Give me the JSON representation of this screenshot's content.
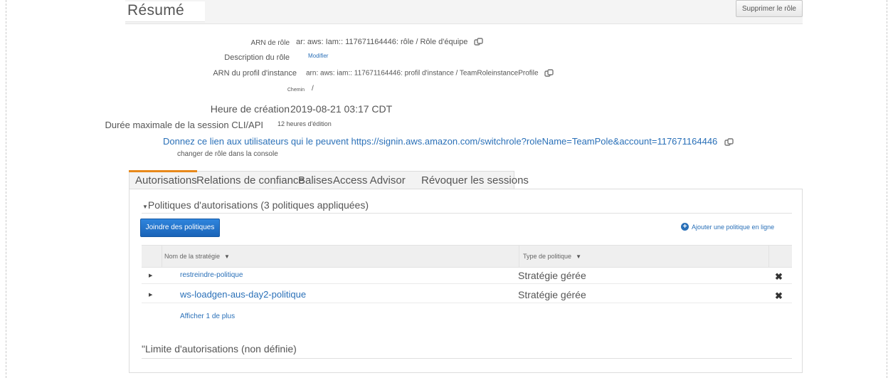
{
  "page": {
    "title": "Résumé",
    "delete_role_label": "Supprimer le rôle"
  },
  "summary": {
    "role_arn": {
      "label": "ARN de rôle",
      "value": "ar: aws: Iam:: 117671164446: rôle / Rôle d'équipe"
    },
    "role_description": {
      "label": "Description du rôle",
      "value": "Modifier"
    },
    "instance_profile_arn": {
      "label": "ARN du profil d'instance",
      "value": "arn: aws: iam:: 117671164446: profil d'instance / TeamRoleinstanceProfile"
    },
    "path": {
      "label": "Chemin",
      "value": "/"
    },
    "creation_time": {
      "label": "Heure de création",
      "value": "2019-08-21 03:17 CDT"
    },
    "max_session": {
      "label": "Durée maximale de la session CLI/API",
      "value": "12 heures d'édition"
    },
    "switch_role": {
      "text": "Donnez ce lien aux utilisateurs qui le peuvent",
      "url": "https://signin.aws.amazon.com/switchrole?roleName=TeamPole&account=117671164446",
      "subtext": "changer de rôle dans la console"
    }
  },
  "tabs": [
    {
      "label": "Autorisations",
      "active": true
    },
    {
      "label": "Relations de confiance",
      "active": false
    },
    {
      "label": "Balises",
      "active": false
    },
    {
      "label": "Access Advisor",
      "active": false
    },
    {
      "label": "Révoquer les sessions",
      "active": false
    }
  ],
  "permissions": {
    "section_title": "Politiques d'autorisations (3 politiques appliquées)",
    "attach_button": "Joindre des politiques",
    "add_inline_link": "Ajouter une politique en ligne",
    "columns": {
      "policy_name": "Nom de la stratégie",
      "policy_type": "Type de politique"
    },
    "rows": [
      {
        "name": "restreindre-politique",
        "type": "Stratégie gérée"
      },
      {
        "name": "ws-loadgen-aus-day2-politique",
        "type": "Stratégie gérée"
      }
    ],
    "show_more": "Afficher 1 de plus",
    "boundary_title": "Limite d'autorisations (non définie)"
  },
  "icons": {
    "copy": "copy-icon",
    "remove": "close-icon",
    "expand": "triangle-right-icon",
    "sort": "caret-down-icon",
    "add": "plus-circle-icon"
  },
  "colors": {
    "link": "#2a70b8",
    "primary_button": "#1f6fc5",
    "active_tab": "#e8891b"
  }
}
